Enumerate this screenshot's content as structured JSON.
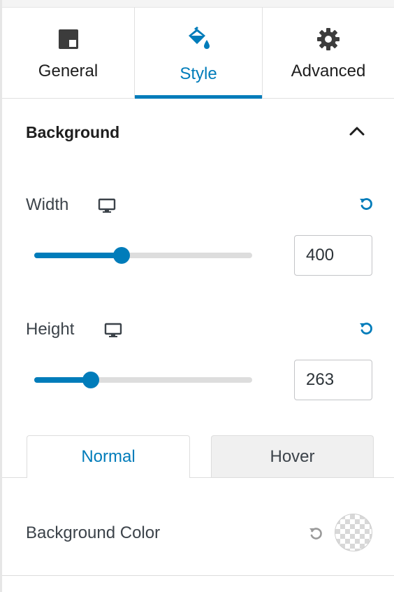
{
  "tabs": {
    "general": {
      "label": "General",
      "icon": "layout-icon"
    },
    "style": {
      "label": "Style",
      "icon": "paint-bucket-icon",
      "active": true
    },
    "advanced": {
      "label": "Advanced",
      "icon": "gear-icon"
    }
  },
  "section": {
    "title": "Background",
    "expanded": true
  },
  "width_control": {
    "label": "Width",
    "value": "400",
    "slider_fraction": 0.4,
    "device_icon": "desktop-icon"
  },
  "height_control": {
    "label": "Height",
    "value": "263",
    "slider_fraction": 0.26,
    "device_icon": "desktop-icon"
  },
  "state_tabs": {
    "normal": "Normal",
    "hover": "Hover",
    "active": "normal"
  },
  "background_color": {
    "label": "Background Color",
    "value": "transparent"
  },
  "colors": {
    "accent": "#007cba",
    "track": "#dddddd",
    "text": "#1e1e1e",
    "muted_text": "#3c434a"
  }
}
